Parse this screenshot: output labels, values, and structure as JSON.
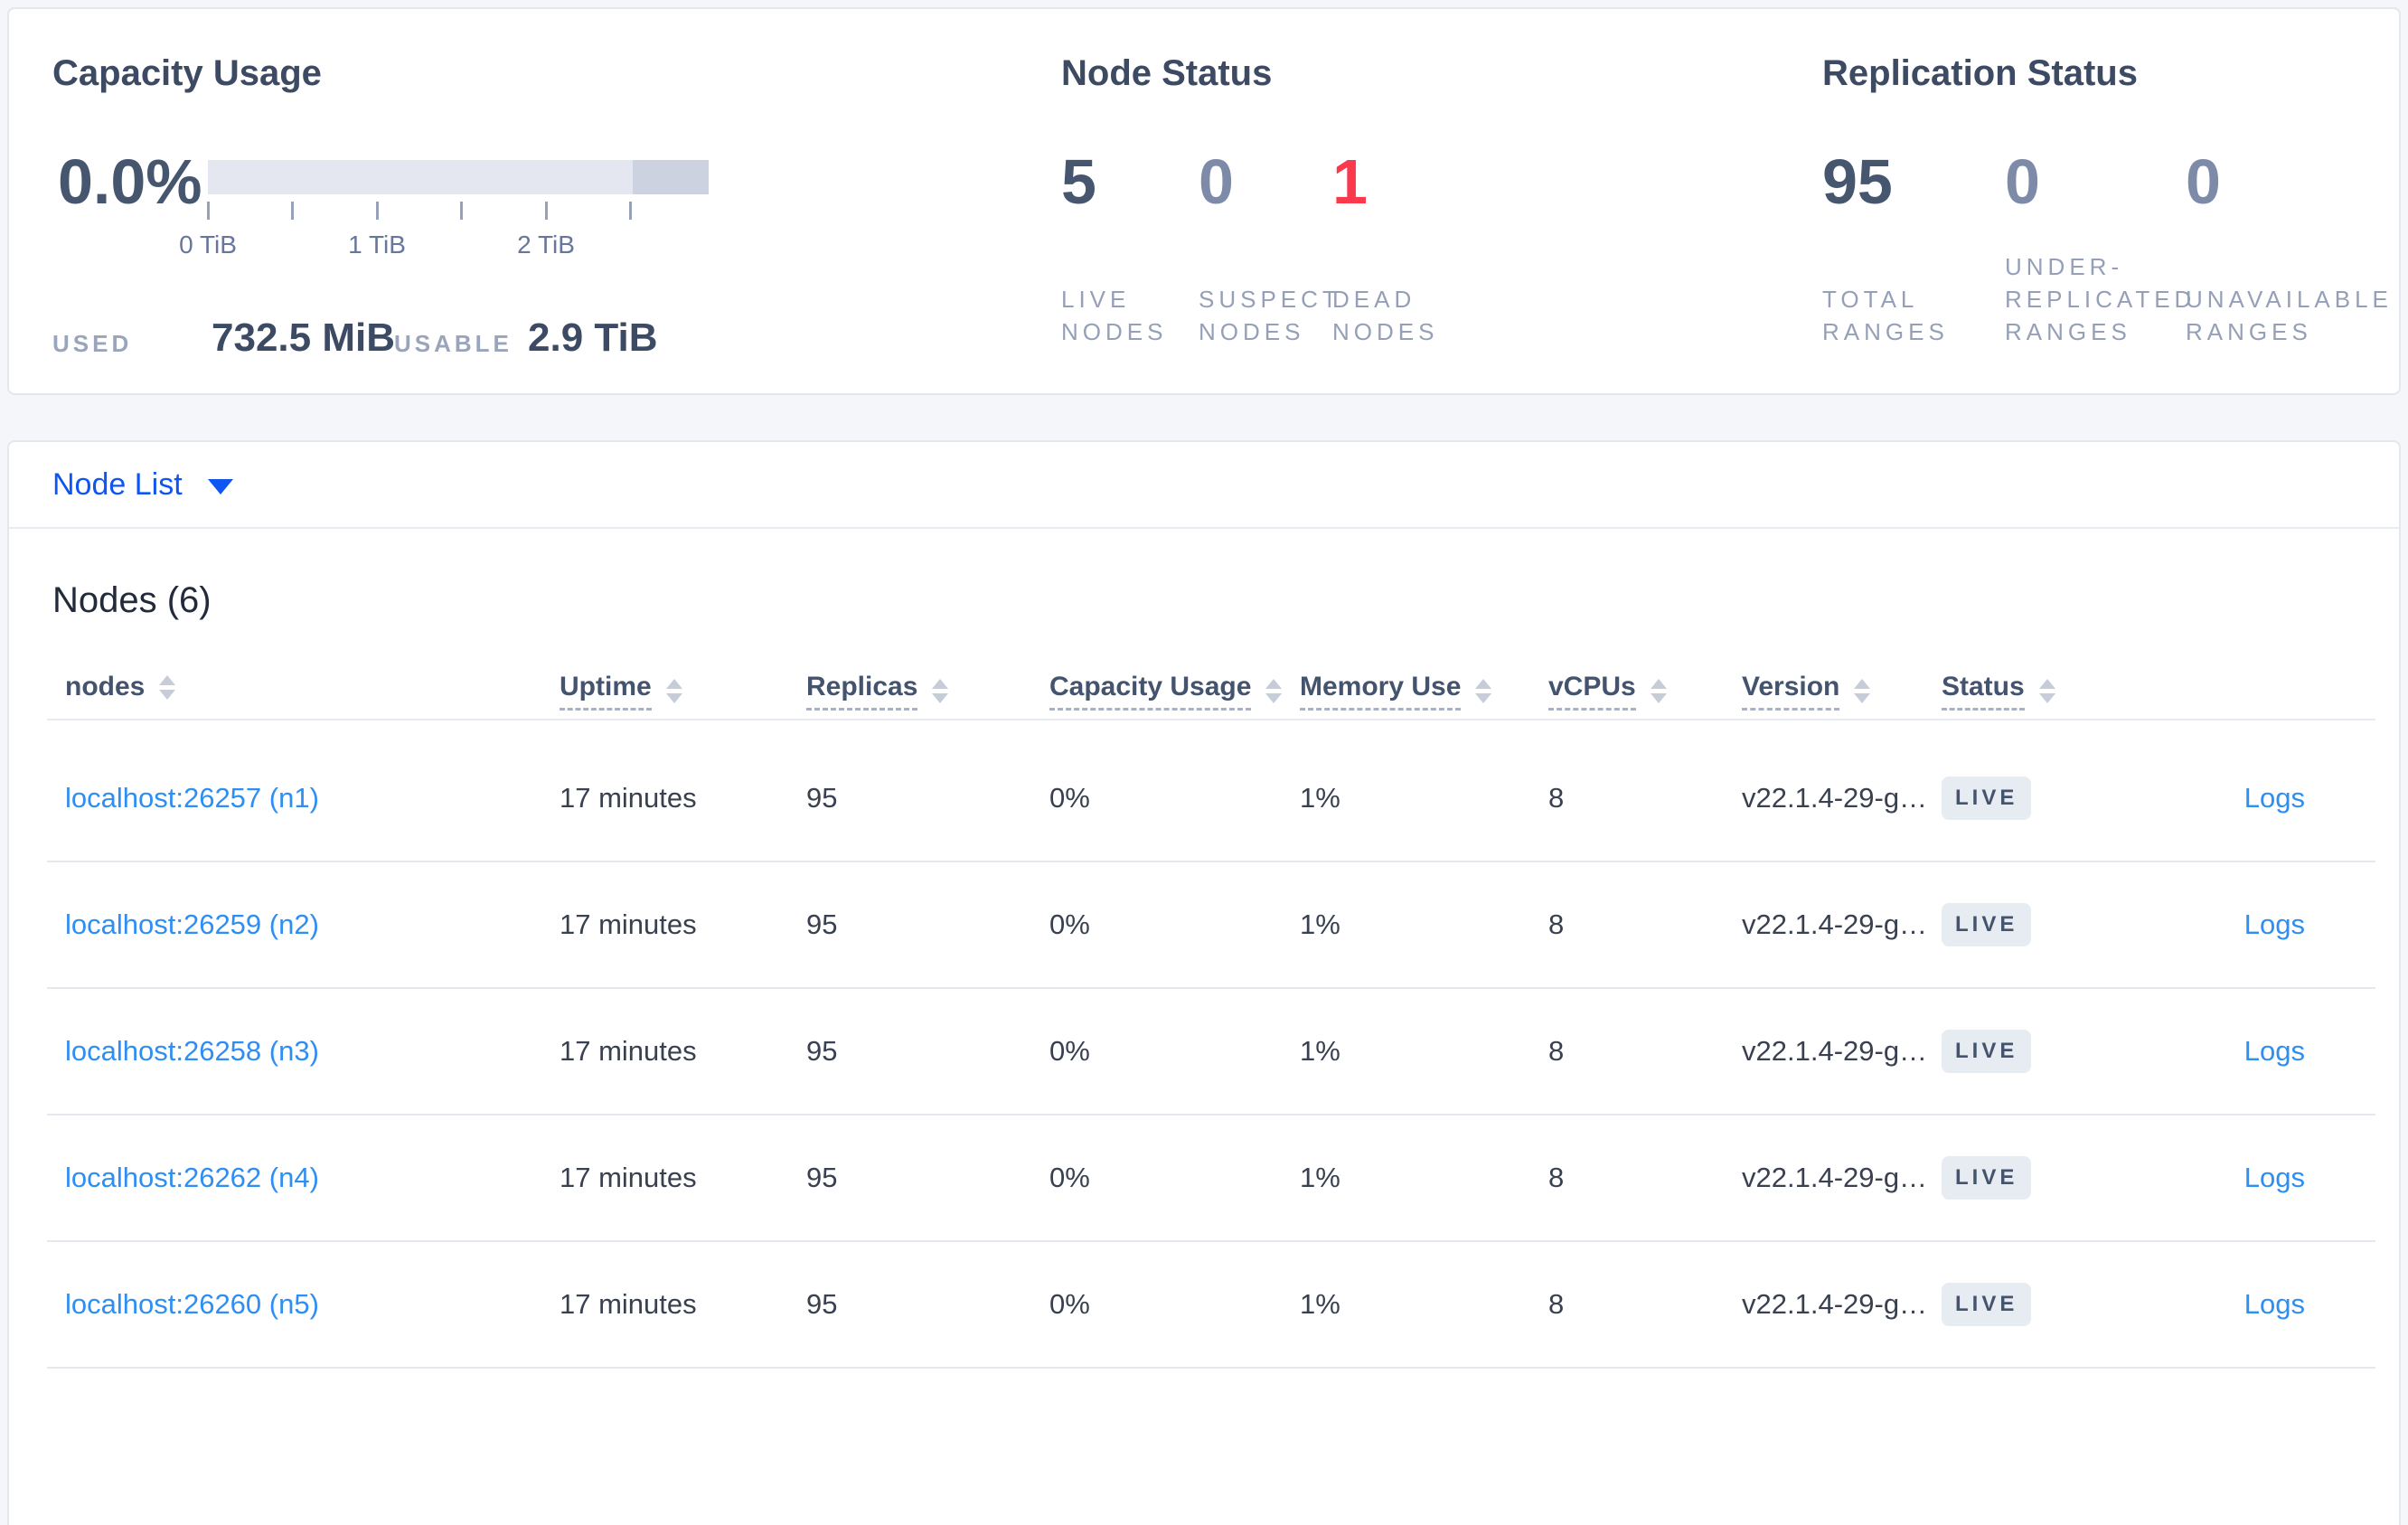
{
  "summary": {
    "capacity": {
      "title": "Capacity Usage",
      "percent": "0.0%",
      "tick_labels": [
        "0 TiB",
        "1 TiB",
        "2 TiB"
      ],
      "used_label": "USED",
      "used_value": "732.5 MiB",
      "usable_label": "USABLE",
      "usable_value": "2.9 TiB"
    },
    "node_status": {
      "title": "Node Status",
      "stats": [
        {
          "value": "5",
          "tone": "dark",
          "label_lines": [
            "LIVE",
            "NODES"
          ]
        },
        {
          "value": "0",
          "tone": "muted",
          "label_lines": [
            "SUSPECT",
            "NODES"
          ]
        },
        {
          "value": "1",
          "tone": "danger",
          "label_lines": [
            "DEAD",
            "NODES"
          ]
        }
      ]
    },
    "replication_status": {
      "title": "Replication Status",
      "stats": [
        {
          "value": "95",
          "tone": "dark",
          "label_lines": [
            "TOTAL",
            "RANGES"
          ]
        },
        {
          "value": "0",
          "tone": "muted",
          "label_lines": [
            "UNDER-",
            "REPLICATED",
            "RANGES"
          ]
        },
        {
          "value": "0",
          "tone": "muted",
          "label_lines": [
            "UNAVAILABLE",
            "RANGES"
          ]
        }
      ]
    }
  },
  "view_selector": {
    "label": "Node List",
    "caret_icon": "triangle-down"
  },
  "nodes_table": {
    "heading": "Nodes (6)",
    "columns": [
      {
        "label": "nodes",
        "sortable": true,
        "underlined": false
      },
      {
        "label": "Uptime",
        "sortable": true,
        "underlined": true
      },
      {
        "label": "Replicas",
        "sortable": true,
        "underlined": true
      },
      {
        "label": "Capacity Usage",
        "sortable": true,
        "underlined": true
      },
      {
        "label": "Memory Use",
        "sortable": true,
        "underlined": true
      },
      {
        "label": "vCPUs",
        "sortable": true,
        "underlined": true
      },
      {
        "label": "Version",
        "sortable": true,
        "underlined": true
      },
      {
        "label": "Status",
        "sortable": true,
        "underlined": true
      }
    ],
    "rows": [
      {
        "node": "localhost:26257 (n1)",
        "uptime": "17 minutes",
        "replicas": "95",
        "capacity_usage": "0%",
        "memory_use": "1%",
        "vcpus": "8",
        "version": "v22.1.4-29-g…",
        "status": "LIVE",
        "logs_label": "Logs"
      },
      {
        "node": "localhost:26259 (n2)",
        "uptime": "17 minutes",
        "replicas": "95",
        "capacity_usage": "0%",
        "memory_use": "1%",
        "vcpus": "8",
        "version": "v22.1.4-29-g…",
        "status": "LIVE",
        "logs_label": "Logs"
      },
      {
        "node": "localhost:26258 (n3)",
        "uptime": "17 minutes",
        "replicas": "95",
        "capacity_usage": "0%",
        "memory_use": "1%",
        "vcpus": "8",
        "version": "v22.1.4-29-g…",
        "status": "LIVE",
        "logs_label": "Logs"
      },
      {
        "node": "localhost:26262 (n4)",
        "uptime": "17 minutes",
        "replicas": "95",
        "capacity_usage": "0%",
        "memory_use": "1%",
        "vcpus": "8",
        "version": "v22.1.4-29-g…",
        "status": "LIVE",
        "logs_label": "Logs"
      },
      {
        "node": "localhost:26260 (n5)",
        "uptime": "17 minutes",
        "replicas": "95",
        "capacity_usage": "0%",
        "memory_use": "1%",
        "vcpus": "8",
        "version": "v22.1.4-29-g…",
        "status": "LIVE",
        "logs_label": "Logs"
      }
    ]
  },
  "colors": {
    "accent_blue": "#0f55f2",
    "link_blue": "#2f8ef2",
    "danger_red": "#fb394d",
    "badge_bg": "#e7ebf2",
    "page_bg": "#f4f6fa"
  }
}
